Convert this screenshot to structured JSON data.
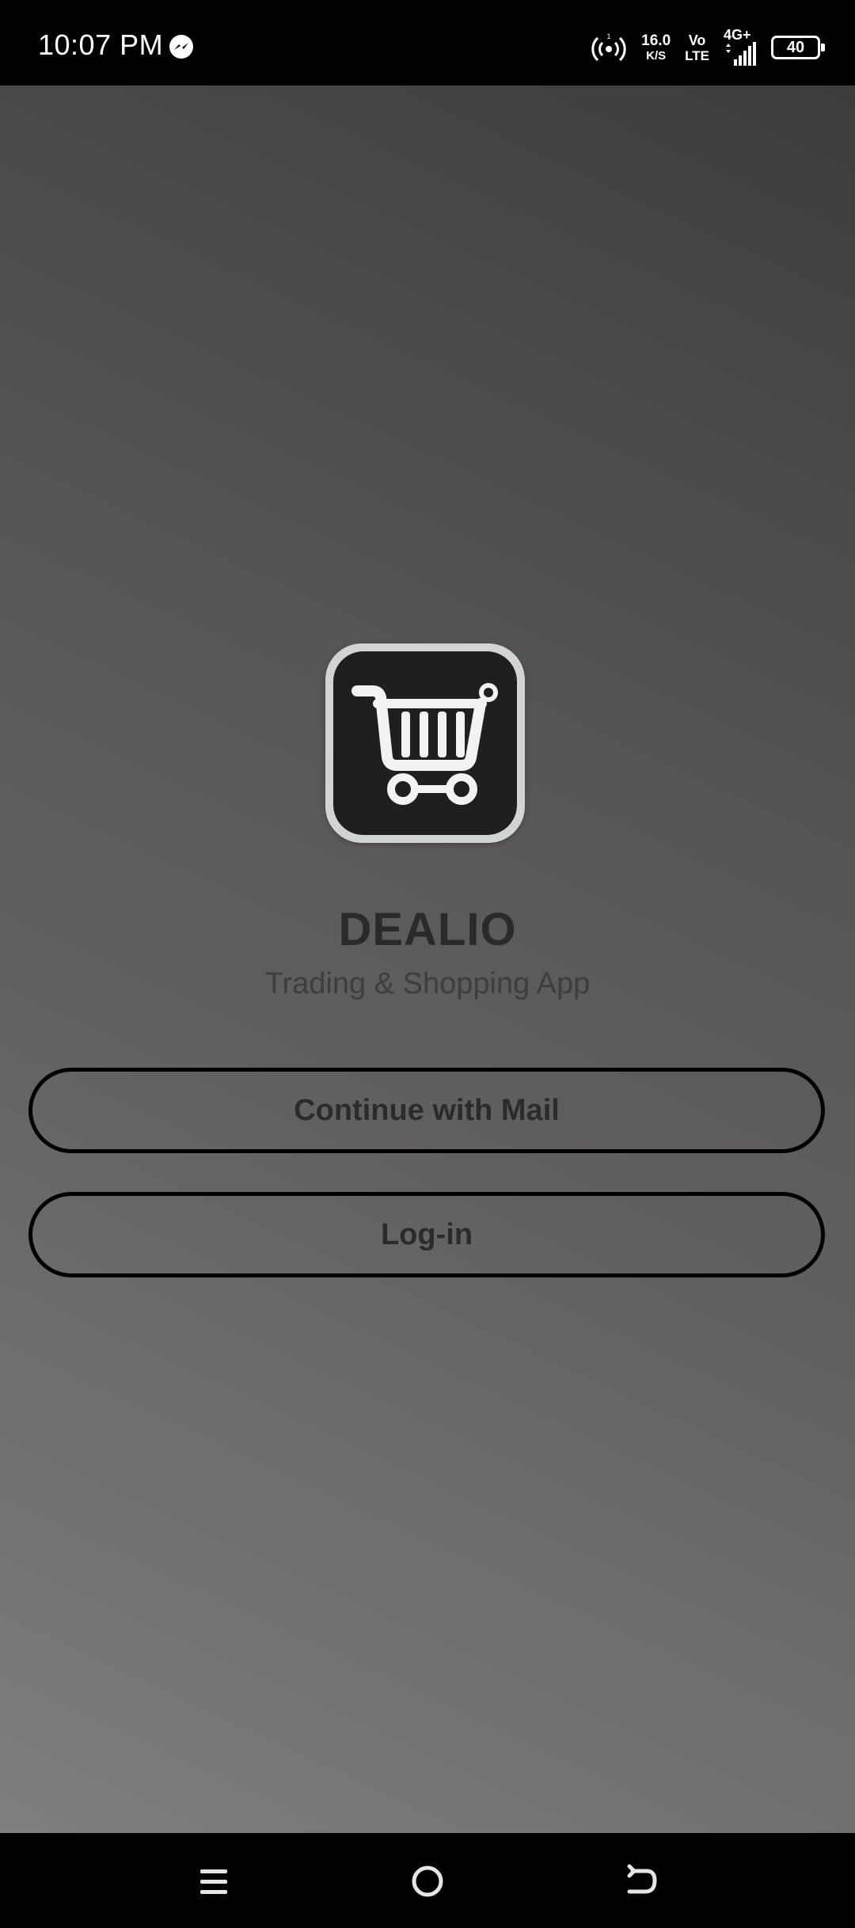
{
  "status_bar": {
    "time": "10:07 PM",
    "left_icon": "messenger-icon",
    "hotspot_badge": "1",
    "speed_value": "16.0",
    "speed_unit": "K/S",
    "volte_top": "Vo",
    "volte_bottom": "LTE",
    "network": "4G+",
    "battery": "40"
  },
  "app": {
    "logo_icon": "shopping-cart-icon",
    "name": "DEALIO",
    "tagline": "Trading & Shopping App"
  },
  "actions": {
    "continue_mail_label": "Continue with Mail",
    "login_label": "Log-in"
  },
  "nav_bar": {
    "icons": [
      "menu-icon",
      "home-icon",
      "back-icon"
    ]
  },
  "colors": {
    "background_top_right": "#3f3c3c",
    "background_bottom_left": "#7e7e7e",
    "logo_dark": "#1d1f21",
    "text_dark": "#2a2a2c",
    "button_border": "#000000"
  }
}
